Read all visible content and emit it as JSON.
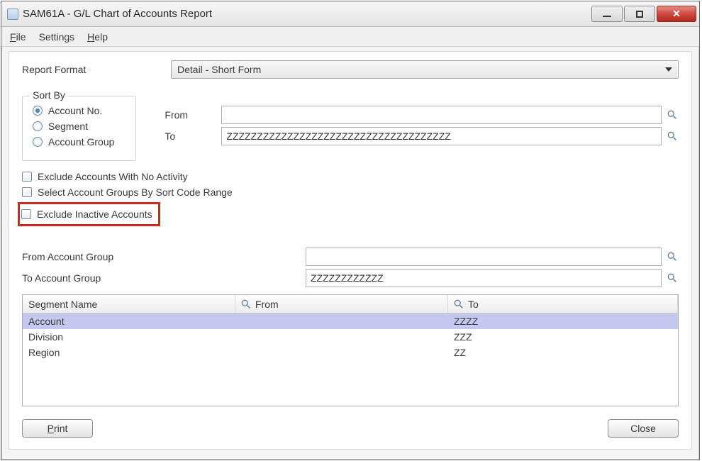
{
  "window": {
    "title": "SAM61A - G/L Chart of Accounts Report"
  },
  "menu": {
    "file": "File",
    "settings": "Settings",
    "help": "Help"
  },
  "labels": {
    "report_format": "Report Format",
    "sort_by": "Sort By",
    "from": "From",
    "to": "To",
    "from_account_group": "From Account Group",
    "to_account_group": "To Account Group"
  },
  "report_format": {
    "selected": "Detail - Short Form"
  },
  "sort": {
    "options": {
      "account_no": "Account No.",
      "segment": "Segment",
      "account_group": "Account Group"
    },
    "selected": "account_no"
  },
  "range": {
    "from": "",
    "to": "ZZZZZZZZZZZZZZZZZZZZZZZZZZZZZZZZZZZZZ"
  },
  "checkboxes": {
    "exclude_no_activity": "Exclude Accounts With No Activity",
    "select_groups_by_sortcode": "Select Account Groups By Sort Code Range",
    "exclude_inactive": "Exclude Inactive Accounts"
  },
  "account_group": {
    "from": "",
    "to": "ZZZZZZZZZZZZ"
  },
  "grid": {
    "headers": {
      "segment_name": "Segment Name",
      "from": "From",
      "to": "To"
    },
    "rows": [
      {
        "segment": "Account",
        "from": "",
        "to": "ZZZZ",
        "selected": true
      },
      {
        "segment": "Division",
        "from": "",
        "to": "ZZZ",
        "selected": false
      },
      {
        "segment": "Region",
        "from": "",
        "to": "ZZ",
        "selected": false
      }
    ]
  },
  "buttons": {
    "print": "Print",
    "close": "Close"
  }
}
